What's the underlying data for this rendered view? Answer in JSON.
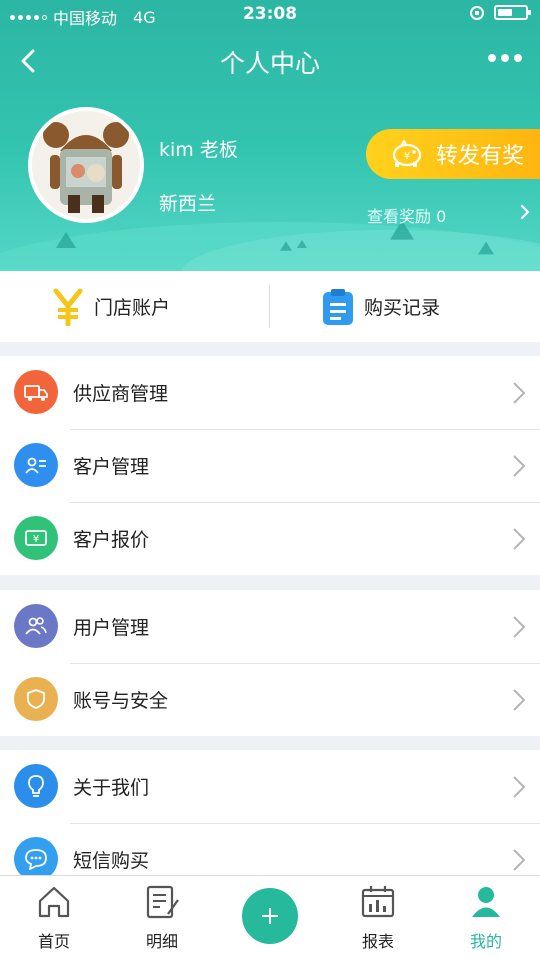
{
  "status_bar": {
    "carrier": "中国移动",
    "network": "4G",
    "time": "23:08",
    "battery_level": 0.55
  },
  "nav": {
    "title": "个人中心",
    "back_icon": "chevron-left-icon",
    "more_icon": "more-dots-icon"
  },
  "profile": {
    "name": "kim 老板",
    "location": "新西兰"
  },
  "reward": {
    "button_label": "转发有奖",
    "view_rewards": "查看奖励 0"
  },
  "quick_actions": [
    {
      "label": "门店账户",
      "icon": "yuan-icon"
    },
    {
      "label": "购买记录",
      "icon": "clipboard-icon"
    }
  ],
  "menu_groups": [
    {
      "items": [
        {
          "label": "供应商管理",
          "icon": "truck-icon",
          "color": "#f2653a"
        },
        {
          "label": "客户管理",
          "icon": "contact-card-icon",
          "color": "#2f8fef"
        },
        {
          "label": "客户报价",
          "icon": "price-tag-icon",
          "color": "#2fc278"
        }
      ]
    },
    {
      "items": [
        {
          "label": "用户管理",
          "icon": "users-icon",
          "color": "#6b78c6"
        },
        {
          "label": "账号与安全",
          "icon": "shield-icon",
          "color": "#eab152"
        }
      ]
    },
    {
      "items": [
        {
          "label": "关于我们",
          "icon": "lightbulb-icon",
          "color": "#2b8eea"
        },
        {
          "label": "短信购买",
          "icon": "message-icon",
          "color": "#33a0ef"
        }
      ]
    }
  ],
  "tabbar": {
    "tabs": [
      {
        "label": "首页",
        "icon": "home-icon"
      },
      {
        "label": "明细",
        "icon": "edit-list-icon"
      },
      {
        "label": "",
        "icon": "add-icon"
      },
      {
        "label": "报表",
        "icon": "report-chart-icon"
      },
      {
        "label": "我的",
        "icon": "profile-icon"
      }
    ]
  },
  "colors": {
    "header": "#33c4b0",
    "reward": "#ffc21a",
    "accent": "#27b99b"
  }
}
